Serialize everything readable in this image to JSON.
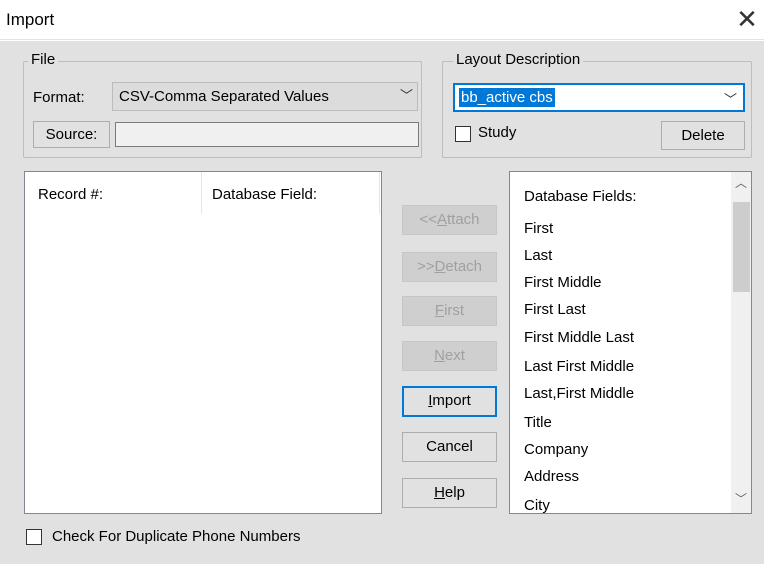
{
  "window": {
    "title": "Import",
    "close_glyph": "✕"
  },
  "file_group": {
    "legend": "File",
    "format_label": "Format:",
    "format_value": "CSV-Comma Separated Values",
    "source_button": "Source:",
    "source_value": ""
  },
  "layout_group": {
    "legend": "Layout Description",
    "selected": "bb_active cbs",
    "study_label": "Study",
    "study_checked": false,
    "delete_button": "Delete"
  },
  "mapping_list": {
    "columns": [
      "Record #:",
      "Database Field:"
    ]
  },
  "buttons": {
    "attach": {
      "prefix": "<<",
      "accel": "A",
      "rest": "ttach",
      "enabled": false
    },
    "detach": {
      "prefix": ">>",
      "accel": "D",
      "rest": "etach",
      "enabled": false
    },
    "first": {
      "prefix": "",
      "accel": "F",
      "rest": "irst",
      "enabled": false
    },
    "next": {
      "prefix": "",
      "accel": "N",
      "rest": "ext",
      "enabled": false
    },
    "import": {
      "prefix": "",
      "accel": "I",
      "rest": "mport",
      "enabled": true,
      "default": true
    },
    "cancel": {
      "label": "Cancel",
      "enabled": true
    },
    "help": {
      "prefix": "",
      "accel": "H",
      "rest": "elp",
      "enabled": true
    }
  },
  "database_fields": {
    "header": "Database Fields:",
    "items": [
      "First",
      "Last",
      "First Middle",
      "First Last",
      "First Middle Last",
      "Last First Middle",
      "Last,First Middle",
      "Title",
      "Company",
      "Address",
      "City"
    ]
  },
  "duplicate_check": {
    "label": "Check For Duplicate Phone Numbers",
    "checked": false
  },
  "colors": {
    "accent": "#0078d7",
    "dialog_bg": "#e1e1e1",
    "disabled_text": "#a0a0a0"
  }
}
